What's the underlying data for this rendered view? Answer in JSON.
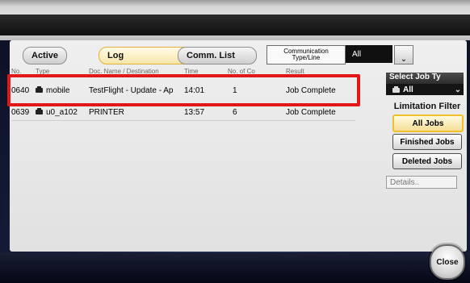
{
  "tabs": {
    "active": "Active",
    "log": "Log",
    "comm_list": "Comm. List"
  },
  "comm_type": {
    "label": "Communication\nType/Line",
    "value": "All"
  },
  "table": {
    "headers": [
      "No.",
      "Type",
      "Doc. Name / Destination",
      "Time",
      "No. of Co",
      "Result"
    ],
    "rows": [
      {
        "no": "0640",
        "type": "mobile",
        "doc": "TestFlight - Update - Ap",
        "time": "14:01",
        "count": "1",
        "result": "Job Complete"
      },
      {
        "no": "0639",
        "type": "u0_a102",
        "doc": "PRINTER",
        "time": "13:57",
        "count": "6",
        "result": "Job Complete"
      }
    ]
  },
  "right_panel": {
    "select_job_type_label": "Select Job Ty",
    "select_job_type_value": "All",
    "limitation_filter_title": "Limitation Filter",
    "buttons": [
      "All Jobs",
      "Finished Jobs",
      "Deleted Jobs"
    ],
    "details_label": "Details.."
  },
  "close_label": "Close",
  "colors": {
    "highlight": "#e21818",
    "selected_button": "#f0c12b"
  }
}
